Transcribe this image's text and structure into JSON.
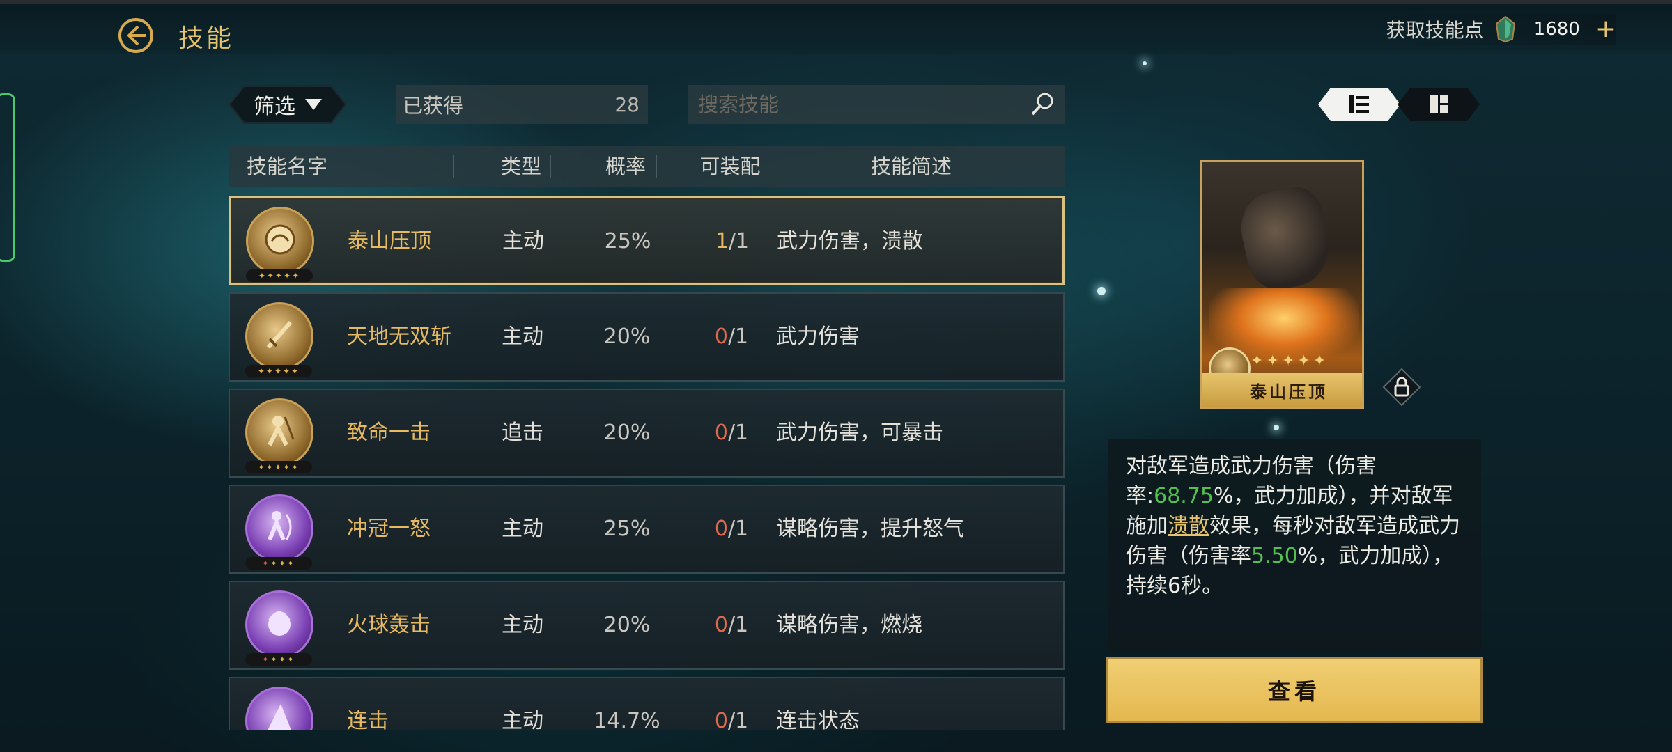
{
  "header": {
    "title": "技能",
    "points_label": "获取技能点",
    "points_value": "1680",
    "plus": "+"
  },
  "controls": {
    "filter_label": "筛选",
    "owned_label": "已获得",
    "owned_count": "28",
    "search_placeholder": "搜索技能"
  },
  "table": {
    "columns": [
      "技能名字",
      "类型",
      "概率",
      "可装配",
      "技能简述"
    ],
    "rows": [
      {
        "name": "泰山压顶",
        "type": "主动",
        "prob": "25%",
        "equip_cur": "1",
        "equip_max": "/1",
        "desc": "武力伤害，溃散",
        "stars": "✦✦✦✦✦"
      },
      {
        "name": "天地无双斩",
        "type": "主动",
        "prob": "20%",
        "equip_cur": "0",
        "equip_max": "/1",
        "desc": "武力伤害",
        "stars": "✦✦✦✦✦"
      },
      {
        "name": "致命一击",
        "type": "追击",
        "prob": "20%",
        "equip_cur": "0",
        "equip_max": "/1",
        "desc": "武力伤害，可暴击",
        "stars": "✦✦✦✦✦"
      },
      {
        "name": "冲冠一怒",
        "type": "主动",
        "prob": "25%",
        "equip_cur": "0",
        "equip_max": "/1",
        "desc": "谋略伤害，提升怒气",
        "stars_red": "✦",
        "stars": "✦✦✦"
      },
      {
        "name": "火球轰击",
        "type": "主动",
        "prob": "20%",
        "equip_cur": "0",
        "equip_max": "/1",
        "desc": "谋略伤害，燃烧",
        "stars_red": "✦",
        "stars": "✦✦✦"
      },
      {
        "name": "连击",
        "type": "主动",
        "prob": "14.7%",
        "equip_cur": "0",
        "equip_max": "/1",
        "desc": "连击状态",
        "stars": ""
      }
    ]
  },
  "detail": {
    "card_name": "泰山压顶",
    "card_stars": "✦✦✦✦✦",
    "desc_parts": {
      "p1": "对敌军造成武力伤害（伤害率:",
      "v1": "68.75",
      "p2": "%，武力加成），并对敌军施加",
      "link": "溃散",
      "p3": "效果，每秒对敌军造成武力伤害（伤害率",
      "v2": "5.50",
      "p4": "%，武力加成），持续6秒。"
    },
    "button_label": "查看"
  },
  "colors": {
    "accent_gold": "#e5c26e",
    "skill_name": "#e7b960",
    "zero_count": "#e26a4c",
    "highlight_green": "#54c050"
  }
}
